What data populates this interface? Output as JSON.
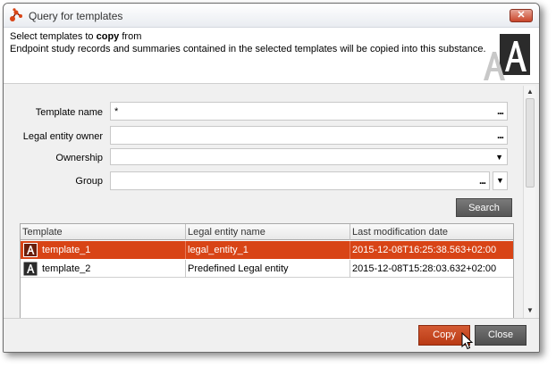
{
  "window": {
    "title": "Query for templates",
    "close_glyph": "✕"
  },
  "header": {
    "line1_prefix": "Select templates to ",
    "line1_bold": "copy",
    "line1_suffix": " from",
    "line2": "Endpoint study records and summaries contained in the selected templates will be copied into this substance."
  },
  "form": {
    "template_name": {
      "label": "Template name",
      "value": "*",
      "dots": "..."
    },
    "legal_entity_owner": {
      "label": "Legal entity owner",
      "value": "",
      "dots": "..."
    },
    "ownership": {
      "label": "Ownership",
      "value": "",
      "arrow": "▼"
    },
    "group": {
      "label": "Group",
      "value": "",
      "dots": "...",
      "arrow": "▼"
    },
    "search_label": "Search"
  },
  "table": {
    "columns": [
      "Template",
      "Legal entity name",
      "Last modification date"
    ],
    "rows": [
      {
        "template": "template_1",
        "legal_entity": "legal_entity_1",
        "modified": "2015-12-08T16:25:38.563+02:00",
        "selected": true
      },
      {
        "template": "template_2",
        "legal_entity": "Predefined Legal entity",
        "modified": "2015-12-08T15:28:03.632+02:00",
        "selected": false
      }
    ]
  },
  "footer": {
    "copy_label": "Copy",
    "close_label": "Close"
  },
  "scroll": {
    "up": "▲",
    "down": "▼"
  },
  "colors": {
    "accent": "#d84416",
    "button_dark": "#5e5e5e"
  }
}
